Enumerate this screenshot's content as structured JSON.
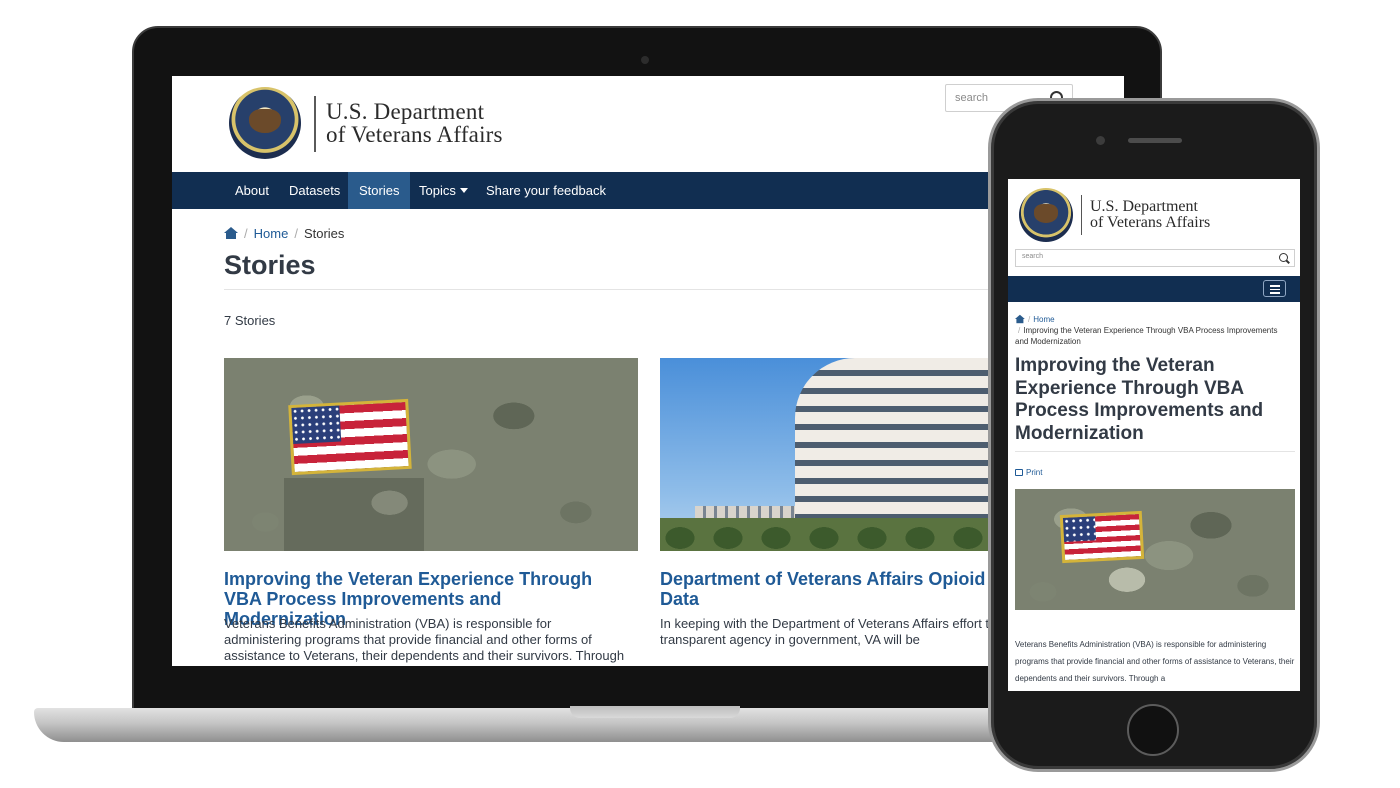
{
  "laptop": {
    "header": {
      "org_line1": "U.S. Department",
      "org_line2": "of Veterans Affairs",
      "search_placeholder": "search"
    },
    "nav": {
      "items": [
        {
          "label": "About",
          "active": false
        },
        {
          "label": "Datasets",
          "active": false
        },
        {
          "label": "Stories",
          "active": true
        },
        {
          "label": "Topics",
          "active": false,
          "has_dropdown": true
        },
        {
          "label": "Share your feedback",
          "active": false
        }
      ]
    },
    "breadcrumb": {
      "home": "Home",
      "current": "Stories"
    },
    "page_title": "Stories",
    "story_count": "7 Stories",
    "cards": [
      {
        "title": "Improving the Veteran Experience Through VBA Process Improvements and Modernization",
        "excerpt": "Veterans Benefits Administration (VBA) is responsible for administering programs that provide financial and other forms of assistance to Veterans, their dependents and their survivors. Through a variety of modernization"
      },
      {
        "title": "Department of Veterans Affairs Opioid P... Data",
        "title_line1": "Department of Veterans Affairs Opioid P",
        "title_line2": "Data",
        "excerpt_line1": "In keeping with the Department of Veterans Affairs effort to b",
        "excerpt_line2": "transparent agency in government, VA will be"
      }
    ]
  },
  "phone": {
    "header": {
      "org_line1": "U.S. Department",
      "org_line2": "of Veterans Affairs",
      "search_placeholder": "search"
    },
    "breadcrumb": {
      "home": "Home",
      "current": "Improving the Veteran Experience Through VBA Process Improvements and Modernization"
    },
    "article_title": "Improving the Veteran Experience Through VBA Process Improvements and Modernization",
    "print_label": "Print",
    "excerpt": "Veterans Benefits Administration (VBA) is responsible for administering programs that provide financial and other forms of assistance to Veterans, their dependents and their survivors. Through a"
  },
  "colors": {
    "nav_bg": "#112e51",
    "nav_active": "#2a5b8c",
    "link": "#1f5a96",
    "text": "#323a45"
  },
  "icons": [
    "va-seal-icon",
    "search-icon",
    "home-icon",
    "caret-down-icon",
    "menu-icon",
    "print-icon"
  ]
}
